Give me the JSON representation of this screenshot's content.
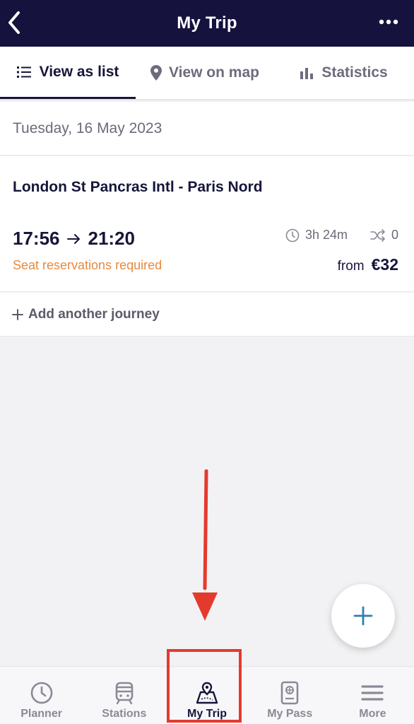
{
  "header": {
    "title": "My Trip",
    "back_icon": "chevron-left-icon",
    "more_icon": "more-dots-icon"
  },
  "tabs": [
    {
      "label": "View as list",
      "icon": "list-icon",
      "active": true
    },
    {
      "label": "View on map",
      "icon": "map-pin-icon",
      "active": false
    },
    {
      "label": "Statistics",
      "icon": "bar-chart-icon",
      "active": false
    }
  ],
  "date": "Tuesday, 16 May 2023",
  "journey": {
    "route": "London St Pancras Intl - Paris Nord",
    "departure": "17:56",
    "arrival": "21:20",
    "duration": "3h 24m",
    "changes": "0",
    "notice": "Seat reservations required",
    "price_prefix": "from",
    "price": "€32"
  },
  "add_journey_label": "Add another journey",
  "bottom_nav": [
    {
      "label": "Planner",
      "icon": "clock-icon",
      "active": false
    },
    {
      "label": "Stations",
      "icon": "train-icon",
      "active": false
    },
    {
      "label": "My Trip",
      "icon": "map-trip-icon",
      "active": true
    },
    {
      "label": "My Pass",
      "icon": "passport-icon",
      "active": false
    },
    {
      "label": "More",
      "icon": "menu-icon",
      "active": false
    }
  ],
  "colors": {
    "header_bg": "#15123d",
    "accent_orange": "#e8893c",
    "fab_plus": "#2f7fb0",
    "annotation_red": "#e43a2e"
  }
}
